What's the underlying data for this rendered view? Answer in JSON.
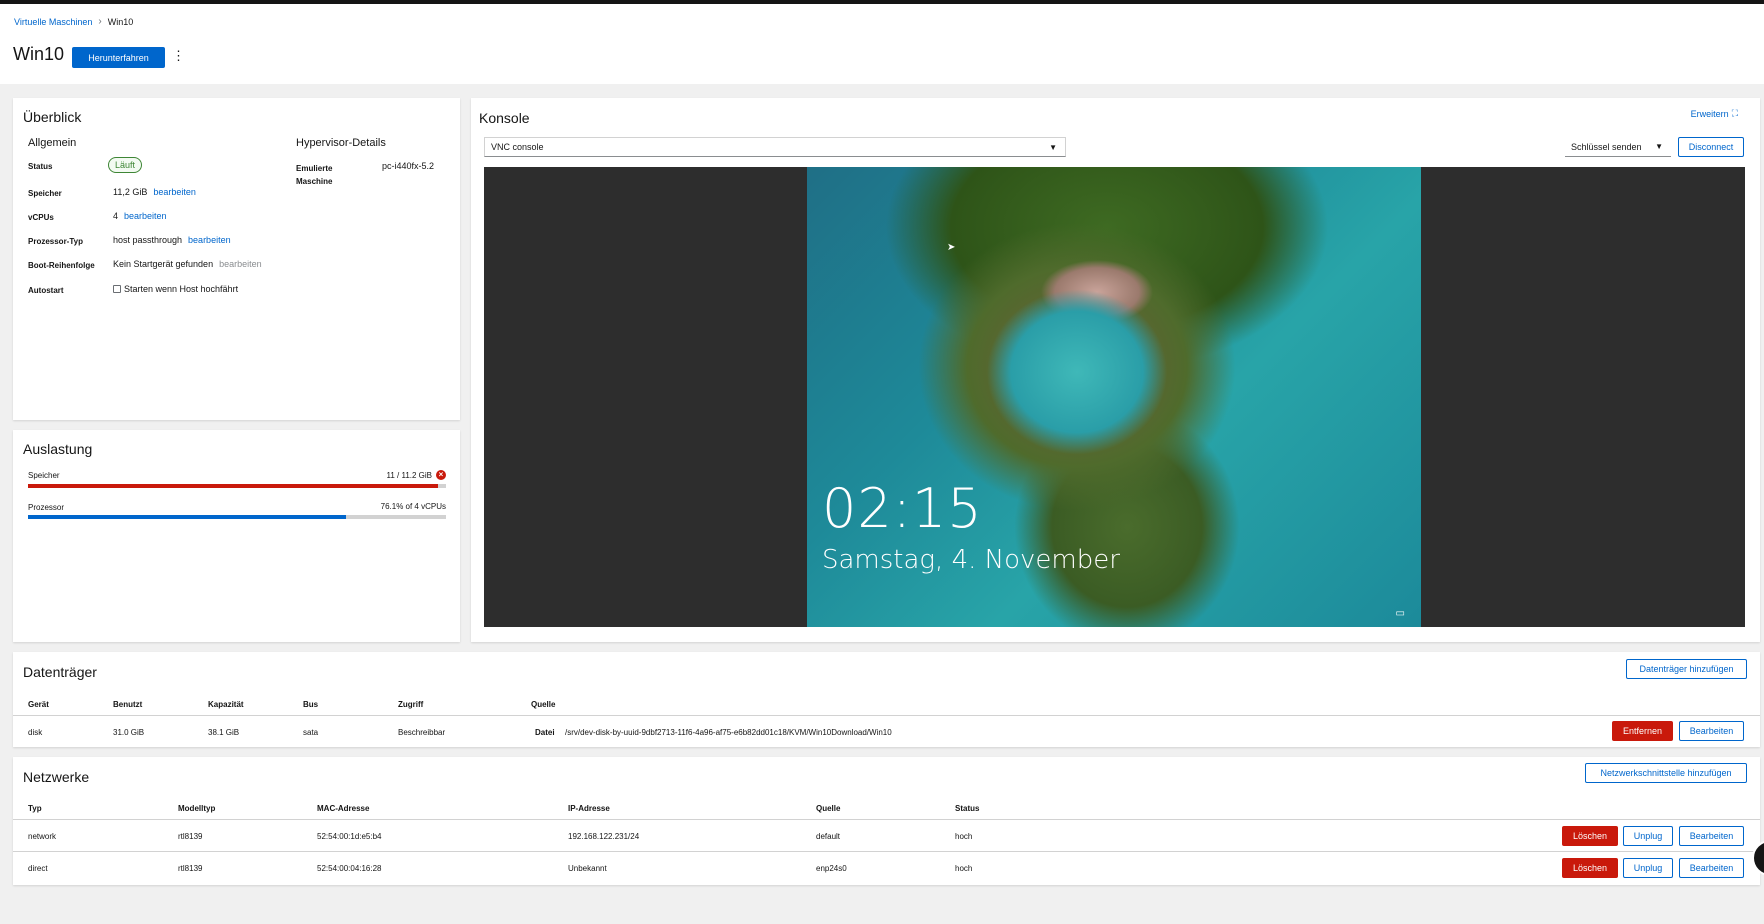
{
  "breadcrumb": {
    "parent": "Virtuelle Maschinen",
    "current": "Win10"
  },
  "page": {
    "title": "Win10",
    "shutdown_label": "Herunterfahren"
  },
  "overview": {
    "title": "Überblick",
    "general_heading": "Allgemein",
    "hypervisor_heading": "Hypervisor-Details",
    "status_label": "Status",
    "status_value": "Läuft",
    "memory_label": "Speicher",
    "memory_value": "11,2 GiB",
    "vcpus_label": "vCPUs",
    "vcpus_value": "4",
    "cpu_type_label": "Prozessor-Typ",
    "cpu_type_value": "host passthrough",
    "boot_label": "Boot-Reihenfolge",
    "boot_value": "Kein Startgerät gefunden",
    "autostart_label": "Autostart",
    "autostart_value": "Starten wenn Host hochfährt",
    "edit_label": "bearbeiten",
    "emulated_label_1": "Emulierte",
    "emulated_label_2": "Maschine",
    "emulated_value": "pc-i440fx-5.2"
  },
  "usage": {
    "title": "Auslastung",
    "memory_label": "Speicher",
    "memory_value": "11 / 11.2 GiB",
    "memory_fraction": 0.98,
    "memory_color": "#c9190b",
    "cpu_label": "Prozessor",
    "cpu_value": "76.1% of 4 vCPUs",
    "cpu_fraction": 0.761,
    "cpu_color": "#0066cc"
  },
  "console": {
    "title": "Konsole",
    "expand_label": "Erweitern",
    "type_selected": "VNC console",
    "send_key_label": "Schlüssel senden",
    "disconnect_label": "Disconnect",
    "clock": "02:15",
    "date": "Samstag, 4. November"
  },
  "disks": {
    "title": "Datenträger",
    "add_label": "Datenträger hinzufügen",
    "columns": [
      "Gerät",
      "Benutzt",
      "Kapazität",
      "Bus",
      "Zugriff",
      "Quelle"
    ],
    "rows": [
      {
        "device": "disk",
        "used": "31.0 GiB",
        "capacity": "38.1 GiB",
        "bus": "sata",
        "access": "Beschreibbar",
        "source_label": "Datei",
        "source_path": "/srv/dev-disk-by-uuid-9dbf2713-11f6-4a96-af75-e6b82dd01c18/KVM/Win10Download/Win10"
      }
    ],
    "remove_label": "Entfernen",
    "edit_label": "Bearbeiten"
  },
  "networks": {
    "title": "Netzwerke",
    "add_label": "Netzwerkschnittstelle hinzufügen",
    "columns": [
      "Typ",
      "Modelltyp",
      "MAC-Adresse",
      "IP-Adresse",
      "Quelle",
      "Status"
    ],
    "rows": [
      {
        "type": "network",
        "model": "rtl8139",
        "mac": "52:54:00:1d:e5:b4",
        "ip": "192.168.122.231/24",
        "source": "default",
        "status": "hoch"
      },
      {
        "type": "direct",
        "model": "rtl8139",
        "mac": "52:54:00:04:16:28",
        "ip": "Unbekannt",
        "source": "enp24s0",
        "status": "hoch"
      }
    ],
    "delete_label": "Löschen",
    "unplug_label": "Unplug",
    "edit_label": "Bearbeiten"
  }
}
